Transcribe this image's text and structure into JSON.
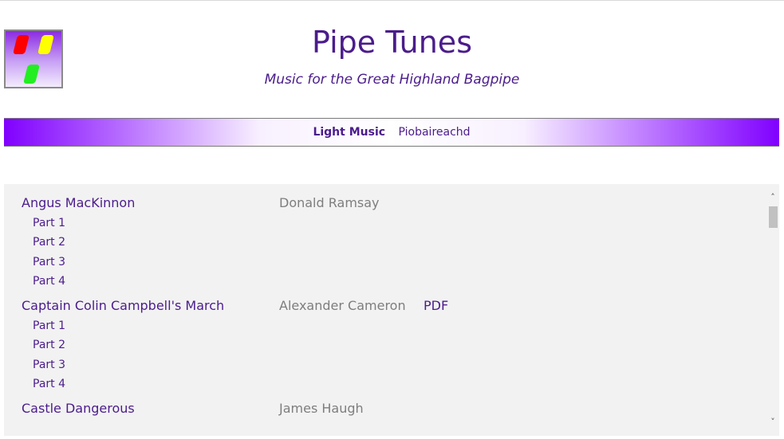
{
  "header": {
    "title": "Pipe Tunes",
    "subtitle": "Music for the Great Highland Bagpipe",
    "logo_icon": "bagpipe-blocks-logo"
  },
  "nav": {
    "items": [
      {
        "label": "Light Music",
        "active": true
      },
      {
        "label": "Piobaireachd",
        "active": false
      }
    ]
  },
  "tunes": [
    {
      "name": "Angus MacKinnon",
      "composer": "Donald Ramsay",
      "pdf": "",
      "parts": [
        "Part 1",
        "Part 2",
        "Part 3",
        "Part 4"
      ]
    },
    {
      "name": "Captain Colin Campbell's March",
      "composer": "Alexander Cameron",
      "pdf": "PDF",
      "parts": [
        "Part 1",
        "Part 2",
        "Part 3",
        "Part 4"
      ]
    },
    {
      "name": "Castle Dangerous",
      "composer": "James Haugh",
      "pdf": "",
      "parts": []
    }
  ],
  "colors": {
    "accent": "#4b1c8c",
    "nav_edge": "#8000ff",
    "composer_text": "#7e7e7e",
    "content_bg": "#f2f2f2"
  }
}
